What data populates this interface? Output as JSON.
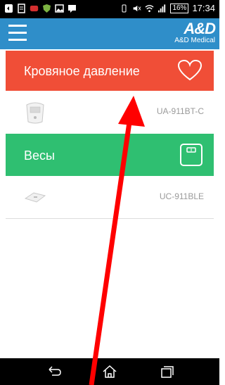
{
  "status_bar": {
    "battery": "16%",
    "time": "17:34"
  },
  "app_bar": {
    "menu_icon": "hamburger-menu-icon",
    "logo_mark": "A&D",
    "logo_text": "A&D Medical"
  },
  "categories": [
    {
      "label": "Кровяное давление",
      "icon": "heart-icon",
      "color": "#f04e37",
      "device_model": "UA-911BT-C",
      "device_icon": "blood-pressure-monitor-icon"
    },
    {
      "label": "Весы",
      "icon": "scale-icon",
      "color": "#2fbf71",
      "device_model": "UC-911BLE",
      "device_icon": "bathroom-scale-icon"
    }
  ],
  "nav_bar": {
    "back_icon": "back-icon",
    "home_icon": "home-icon",
    "recents_icon": "recents-icon"
  }
}
